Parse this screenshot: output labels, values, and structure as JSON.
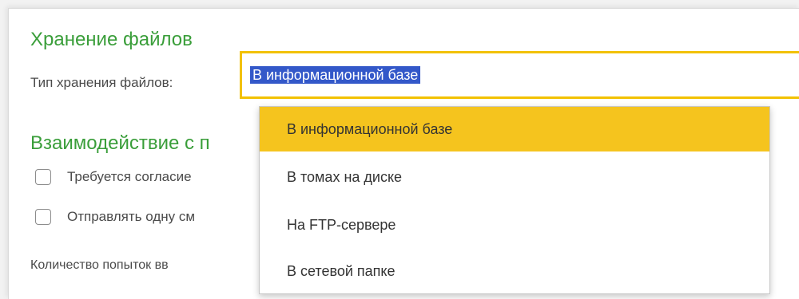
{
  "storage_section": {
    "title": "Хранение файлов",
    "type_label": "Тип хранения файлов:",
    "type_value": "В информационной базе"
  },
  "interaction_section": {
    "title": "Взаимодействие с п"
  },
  "checkboxes": [
    {
      "label": "Требуется согласие",
      "checked": false
    },
    {
      "label": "Отправлять одну см",
      "checked": false
    }
  ],
  "attempts_label": "Количество попыток вв",
  "dropdown": {
    "options": [
      "В информационной базе",
      "В томах на диске",
      "На FTP-сервере",
      "В сетевой папке"
    ],
    "selected_index": 0
  },
  "colors": {
    "section_title": "#3a9e3a",
    "focus_border": "#f2c100",
    "selected_item": "#f5c41e",
    "text_selection": "#3358c9"
  }
}
